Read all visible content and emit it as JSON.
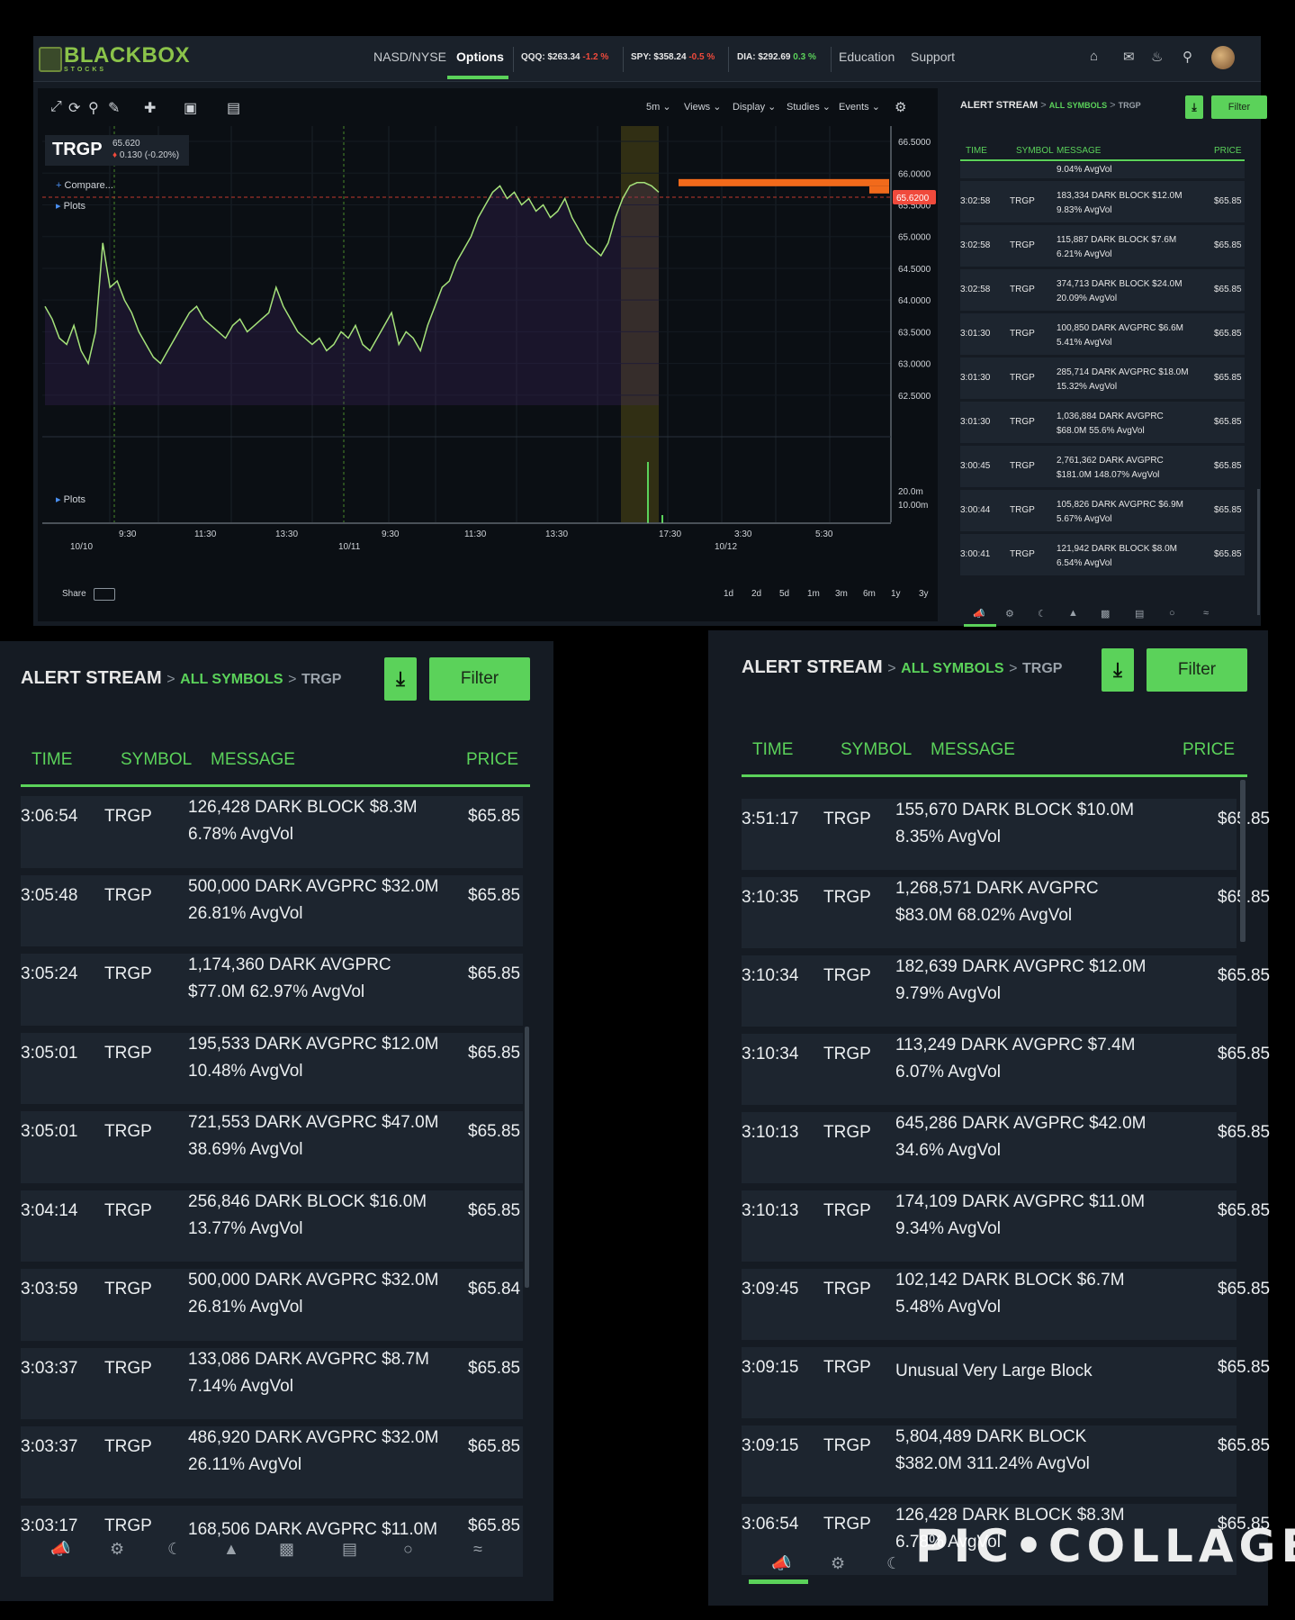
{
  "brand": {
    "name": "BLACKBOX",
    "sub": "STOCKS"
  },
  "nav": {
    "links": [
      "NASD/NYSE",
      "Options",
      "Education",
      "Support"
    ],
    "tickers": [
      {
        "label": "QQQ: $263.34",
        "change": "-1.2 %"
      },
      {
        "label": "SPY: $358.24",
        "change": "-0.5 %"
      },
      {
        "label": "DIA: $292.69",
        "change": "0.3 %"
      }
    ]
  },
  "chart": {
    "symbol": "TRGP",
    "price": "65.620",
    "change": "0.130 (-0.20%)",
    "last_price_tag": "65.6200",
    "toolbar_right": [
      "5m",
      "Views",
      "Display",
      "Studies",
      "Events"
    ],
    "side_labels": [
      "Compare...",
      "Plots",
      "Plots"
    ],
    "share": "Share",
    "ranges": [
      "1d",
      "2d",
      "5d",
      "1m",
      "3m",
      "6m",
      "1y",
      "3y"
    ]
  },
  "chart_data": {
    "type": "line",
    "title": "TRGP",
    "x_ticks": [
      "9:30",
      "11:30",
      "13:30",
      "9:30",
      "11:30",
      "13:30",
      "17:30",
      "3:30",
      "5:30"
    ],
    "date_labels": [
      "10/10",
      "10/11",
      "10/12"
    ],
    "y_ticks": [
      "66.5000",
      "66.0000",
      "65.5000",
      "65.0000",
      "64.5000",
      "64.0000",
      "63.5000",
      "63.0000",
      "62.5000"
    ],
    "volume_ticks": [
      "20.0m",
      "10.00m"
    ],
    "ylim": [
      62.2,
      66.6
    ],
    "series": [
      {
        "values": [
          63.9,
          63.7,
          63.4,
          63.3,
          63.6,
          63.2,
          63.0,
          63.5,
          64.9,
          64.2,
          64.3,
          64.0,
          63.8,
          63.5,
          63.3,
          63.1,
          63.0,
          63.2,
          63.4,
          63.6,
          63.8,
          63.9,
          63.7,
          63.6,
          63.5,
          63.4,
          63.6,
          63.7,
          63.5,
          63.6,
          63.7,
          63.8,
          64.2,
          63.9,
          63.7,
          63.5,
          63.4,
          63.3,
          63.4,
          63.2,
          63.3,
          63.5,
          63.4,
          63.6,
          63.3,
          63.2,
          63.4,
          63.6,
          63.8,
          63.3,
          63.5,
          63.4,
          63.2,
          63.6,
          63.9,
          64.2,
          64.3,
          64.6,
          64.8,
          65.0,
          65.3,
          65.5,
          65.7,
          65.8,
          65.6,
          65.7,
          65.5,
          65.6,
          65.4,
          65.5,
          65.3,
          65.4,
          65.6,
          65.3,
          65.1,
          64.9,
          64.8,
          64.7,
          64.9,
          65.3,
          65.6,
          65.8,
          65.85,
          65.85,
          65.8,
          65.7
        ]
      }
    ]
  },
  "small_panel": {
    "title": "ALERT STREAM",
    "crumb": "ALL SYMBOLS",
    "symbol": "TRGP",
    "filter": "Filter",
    "cols": [
      "TIME",
      "SYMBOL",
      "MESSAGE",
      "PRICE"
    ],
    "partial_row": "9.04% AvgVol",
    "rows": [
      {
        "time": "3:02:58",
        "sym": "TRGP",
        "m1": "183,334 DARK BLOCK $12.0M",
        "m2": "9.83% AvgVol",
        "price": "$65.85"
      },
      {
        "time": "3:02:58",
        "sym": "TRGP",
        "m1": "115,887 DARK BLOCK $7.6M",
        "m2": "6.21% AvgVol",
        "price": "$65.85"
      },
      {
        "time": "3:02:58",
        "sym": "TRGP",
        "m1": "374,713 DARK BLOCK $24.0M",
        "m2": "20.09% AvgVol",
        "price": "$65.85"
      },
      {
        "time": "3:01:30",
        "sym": "TRGP",
        "m1": "100,850 DARK AVGPRC $6.6M",
        "m2": "5.41% AvgVol",
        "price": "$65.85"
      },
      {
        "time": "3:01:30",
        "sym": "TRGP",
        "m1": "285,714 DARK AVGPRC $18.0M",
        "m2": "15.32% AvgVol",
        "price": "$65.85"
      },
      {
        "time": "3:01:30",
        "sym": "TRGP",
        "m1": "1,036,884 DARK AVGPRC",
        "m2": "$68.0M 55.6% AvgVol",
        "price": "$65.85"
      },
      {
        "time": "3:00:45",
        "sym": "TRGP",
        "m1": "2,761,362 DARK AVGPRC",
        "m2": "$181.0M 148.07% AvgVol",
        "price": "$65.85"
      },
      {
        "time": "3:00:44",
        "sym": "TRGP",
        "m1": "105,826 DARK AVGPRC $6.9M",
        "m2": "5.67% AvgVol",
        "price": "$65.85"
      },
      {
        "time": "3:00:41",
        "sym": "TRGP",
        "m1": "121,942 DARK BLOCK $8.0M",
        "m2": "6.54% AvgVol",
        "price": "$65.85"
      }
    ]
  },
  "left_panel": {
    "title": "ALERT STREAM",
    "crumb": "ALL SYMBOLS",
    "symbol": "TRGP",
    "filter": "Filter",
    "cols": [
      "TIME",
      "SYMBOL",
      "MESSAGE",
      "PRICE"
    ],
    "rows": [
      {
        "time": "3:06:54",
        "sym": "TRGP",
        "m1": "126,428 DARK BLOCK $8.3M",
        "m2": "6.78% AvgVol",
        "price": "$65.85"
      },
      {
        "time": "3:05:48",
        "sym": "TRGP",
        "m1": "500,000 DARK AVGPRC $32.0M",
        "m2": "26.81% AvgVol",
        "price": "$65.85"
      },
      {
        "time": "3:05:24",
        "sym": "TRGP",
        "m1": "1,174,360 DARK AVGPRC",
        "m2": "$77.0M 62.97% AvgVol",
        "price": "$65.85"
      },
      {
        "time": "3:05:01",
        "sym": "TRGP",
        "m1": "195,533 DARK AVGPRC $12.0M",
        "m2": "10.48% AvgVol",
        "price": "$65.85"
      },
      {
        "time": "3:05:01",
        "sym": "TRGP",
        "m1": "721,553 DARK AVGPRC $47.0M",
        "m2": "38.69% AvgVol",
        "price": "$65.85"
      },
      {
        "time": "3:04:14",
        "sym": "TRGP",
        "m1": "256,846 DARK BLOCK $16.0M",
        "m2": "13.77% AvgVol",
        "price": "$65.85"
      },
      {
        "time": "3:03:59",
        "sym": "TRGP",
        "m1": "500,000 DARK AVGPRC $32.0M",
        "m2": "26.81% AvgVol",
        "price": "$65.84"
      },
      {
        "time": "3:03:37",
        "sym": "TRGP",
        "m1": "133,086 DARK AVGPRC $8.7M",
        "m2": "7.14% AvgVol",
        "price": "$65.85"
      },
      {
        "time": "3:03:37",
        "sym": "TRGP",
        "m1": "486,920 DARK AVGPRC $32.0M",
        "m2": "26.11% AvgVol",
        "price": "$65.85"
      },
      {
        "time": "3:03:17",
        "sym": "TRGP",
        "m1": "168,506 DARK AVGPRC $11.0M",
        "m2": "",
        "price": "$65.85"
      }
    ]
  },
  "right_panel": {
    "title": "ALERT STREAM",
    "crumb": "ALL SYMBOLS",
    "symbol": "TRGP",
    "filter": "Filter",
    "cols": [
      "TIME",
      "SYMBOL",
      "MESSAGE",
      "PRICE"
    ],
    "rows": [
      {
        "time": "3:51:17",
        "sym": "TRGP",
        "m1": "155,670 DARK BLOCK $10.0M",
        "m2": "8.35% AvgVol",
        "price": "$65.85"
      },
      {
        "time": "3:10:35",
        "sym": "TRGP",
        "m1": "1,268,571 DARK AVGPRC",
        "m2": "$83.0M 68.02% AvgVol",
        "price": "$65.85"
      },
      {
        "time": "3:10:34",
        "sym": "TRGP",
        "m1": "182,639 DARK AVGPRC $12.0M",
        "m2": "9.79% AvgVol",
        "price": "$65.85"
      },
      {
        "time": "3:10:34",
        "sym": "TRGP",
        "m1": "113,249 DARK AVGPRC $7.4M",
        "m2": "6.07% AvgVol",
        "price": "$65.85"
      },
      {
        "time": "3:10:13",
        "sym": "TRGP",
        "m1": "645,286 DARK AVGPRC $42.0M",
        "m2": "34.6% AvgVol",
        "price": "$65.85"
      },
      {
        "time": "3:10:13",
        "sym": "TRGP",
        "m1": "174,109 DARK AVGPRC $11.0M",
        "m2": "9.34% AvgVol",
        "price": "$65.85"
      },
      {
        "time": "3:09:45",
        "sym": "TRGP",
        "m1": "102,142 DARK BLOCK $6.7M",
        "m2": "5.48% AvgVol",
        "price": "$65.85"
      },
      {
        "time": "3:09:15",
        "sym": "TRGP",
        "m1": "Unusual Very Large Block",
        "m2": "",
        "price": "$65.85"
      },
      {
        "time": "3:09:15",
        "sym": "TRGP",
        "m1": "5,804,489 DARK BLOCK",
        "m2": "$382.0M 311.24% AvgVol",
        "price": "$65.85"
      },
      {
        "time": "3:06:54",
        "sym": "TRGP",
        "m1": "126,428 DARK BLOCK $8.3M",
        "m2": "6.78% AvgVol",
        "price": "$65.85"
      }
    ]
  },
  "watermark": "PIC•COLLAGE",
  "colors": {
    "accent": "#5bd25a",
    "panel": "#151b23",
    "row": "#1d252f",
    "line": "#a5e27a",
    "alert": "#f04a3c",
    "orange": "#f26a1b"
  }
}
